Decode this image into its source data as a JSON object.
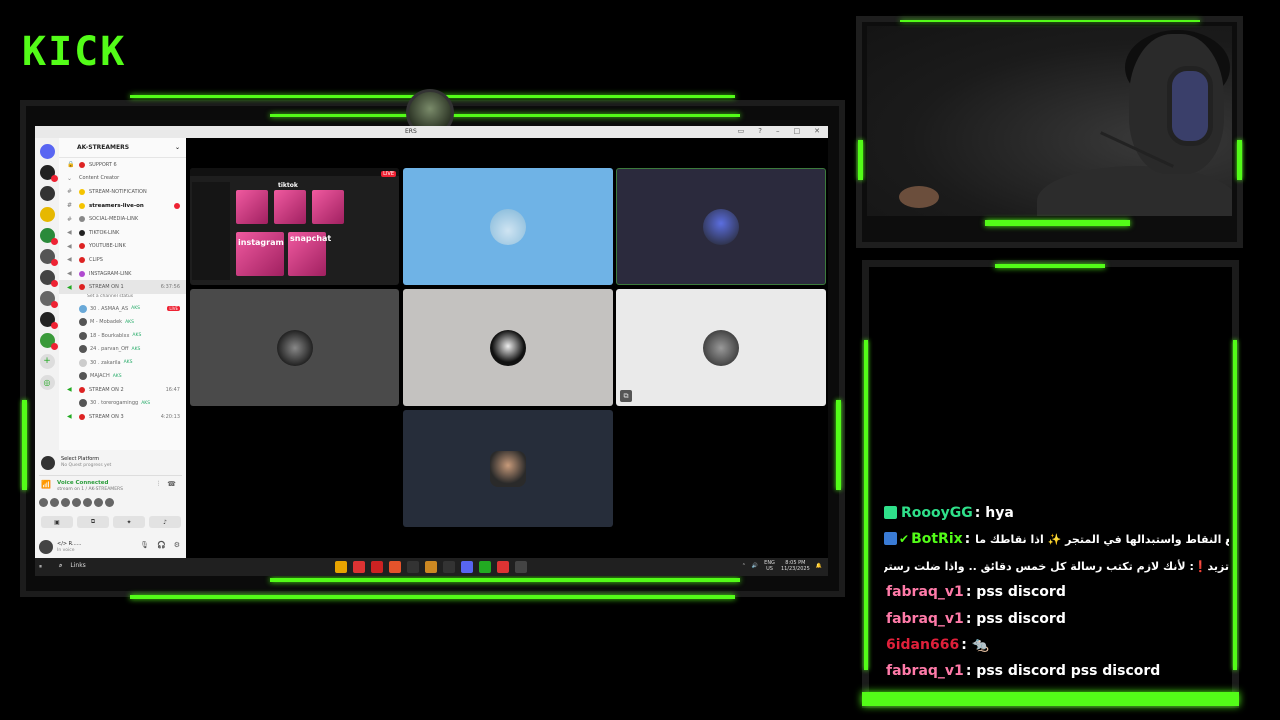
{
  "logo": "KICK",
  "colors": {
    "accent": "#53fc18",
    "background": "#000000"
  },
  "discord": {
    "window_title": "ERS",
    "title_icons": [
      "monitor-icon",
      "help-icon",
      "minimize-icon",
      "maximize-icon",
      "close-icon"
    ],
    "guild_name": "AK-STREAMERS",
    "channels": [
      {
        "type": "text",
        "label": "SUPPORT 6",
        "bold": false
      },
      {
        "type": "category",
        "label": "Content Creator",
        "bold": false
      },
      {
        "type": "text",
        "label": "STREAM-NOTIFICATION",
        "bold": false
      },
      {
        "type": "text",
        "label": "streamers-live-on",
        "bold": true,
        "badge": "2"
      },
      {
        "type": "text",
        "label": "SOCIAL-MEDIA-LINK",
        "bold": false
      },
      {
        "type": "text",
        "label": "TIKTOK-LINK",
        "bold": false
      },
      {
        "type": "text",
        "label": "YOUTUBE-LINK",
        "bold": false
      },
      {
        "type": "text",
        "label": "CLIPS",
        "bold": false
      },
      {
        "type": "text",
        "label": "INSTAGRAM-LINK",
        "bold": false
      }
    ],
    "voice_channel_1": {
      "label": "STREAM ON 1",
      "time": "6:37:56",
      "status": "Set a channel status"
    },
    "voice_users": [
      {
        "name": "30 . ASMAA_AS",
        "tag": "AKS",
        "live": "LIVE"
      },
      {
        "name": "M - Mobadek",
        "tag": "AKS"
      },
      {
        "name": "18 - Bourkablxx",
        "tag": "AKS"
      },
      {
        "name": "24 . parvan_Off",
        "tag": "AKS"
      },
      {
        "name": "30 . zakarila",
        "tag": "AKS"
      },
      {
        "name": "MAJACH",
        "tag": "AKS"
      }
    ],
    "voice_channel_2": {
      "label": "STREAM ON 2",
      "time": "16:47"
    },
    "voice_channel_2_user": {
      "name": "30 . torerogamingg",
      "tag": "AKS"
    },
    "voice_channel_3": {
      "label": "STREAM ON 3",
      "time": "4:20:13"
    },
    "select_platform": {
      "title": "Select Platform",
      "subtitle": "No Quest progress yet"
    },
    "voice_connected": {
      "title": "Voice Connected",
      "subtitle": "stream on 1 / AK-STREAMERS"
    },
    "user_panel": {
      "name": "</> R......",
      "status": "In voice"
    }
  },
  "tiles": {
    "screen": {
      "live": "LIVE",
      "words": [
        "tiktok",
        "instagram",
        "snapchat"
      ]
    }
  },
  "taskbar": {
    "search": "Links",
    "lang": "ENG",
    "region": "US",
    "time": "8:05 PM",
    "date": "11/23/2025"
  },
  "chat": [
    {
      "name": "RoooyGG",
      "color": "#2fe08a",
      "text": "hya",
      "badge_icon": "chat-badge-icon",
      "dir": "ltr"
    },
    {
      "name": "BotRix",
      "color": "#53fc18",
      "text": "طبع جمع النقاط واستبدالها في المتجر ✨ اذا نقاطك ما",
      "badge_icon": "bot-badge-icon",
      "dir": "rtl"
    },
    {
      "name": "",
      "color": "#ffffff",
      "text": "تزيد❗: لأنك لازم تكتب رسالة كل خمس دقائق .. واذا ضلت رستر التطبيق",
      "badge_icon": "",
      "dir": "rtl"
    },
    {
      "name": "fabraq_v1",
      "color": "#ff7aa8",
      "text": "pss discord",
      "badge_icon": "",
      "dir": "ltr"
    },
    {
      "name": "fabraq_v1",
      "color": "#ff7aa8",
      "text": "pss discord",
      "badge_icon": "",
      "dir": "ltr"
    },
    {
      "name": "6idan666",
      "color": "#e0203a",
      "text": "🐀",
      "badge_icon": "",
      "dir": "ltr"
    },
    {
      "name": "fabraq_v1",
      "color": "#ff7aa8",
      "text": "pss discord pss discord",
      "badge_icon": "",
      "dir": "ltr"
    }
  ]
}
